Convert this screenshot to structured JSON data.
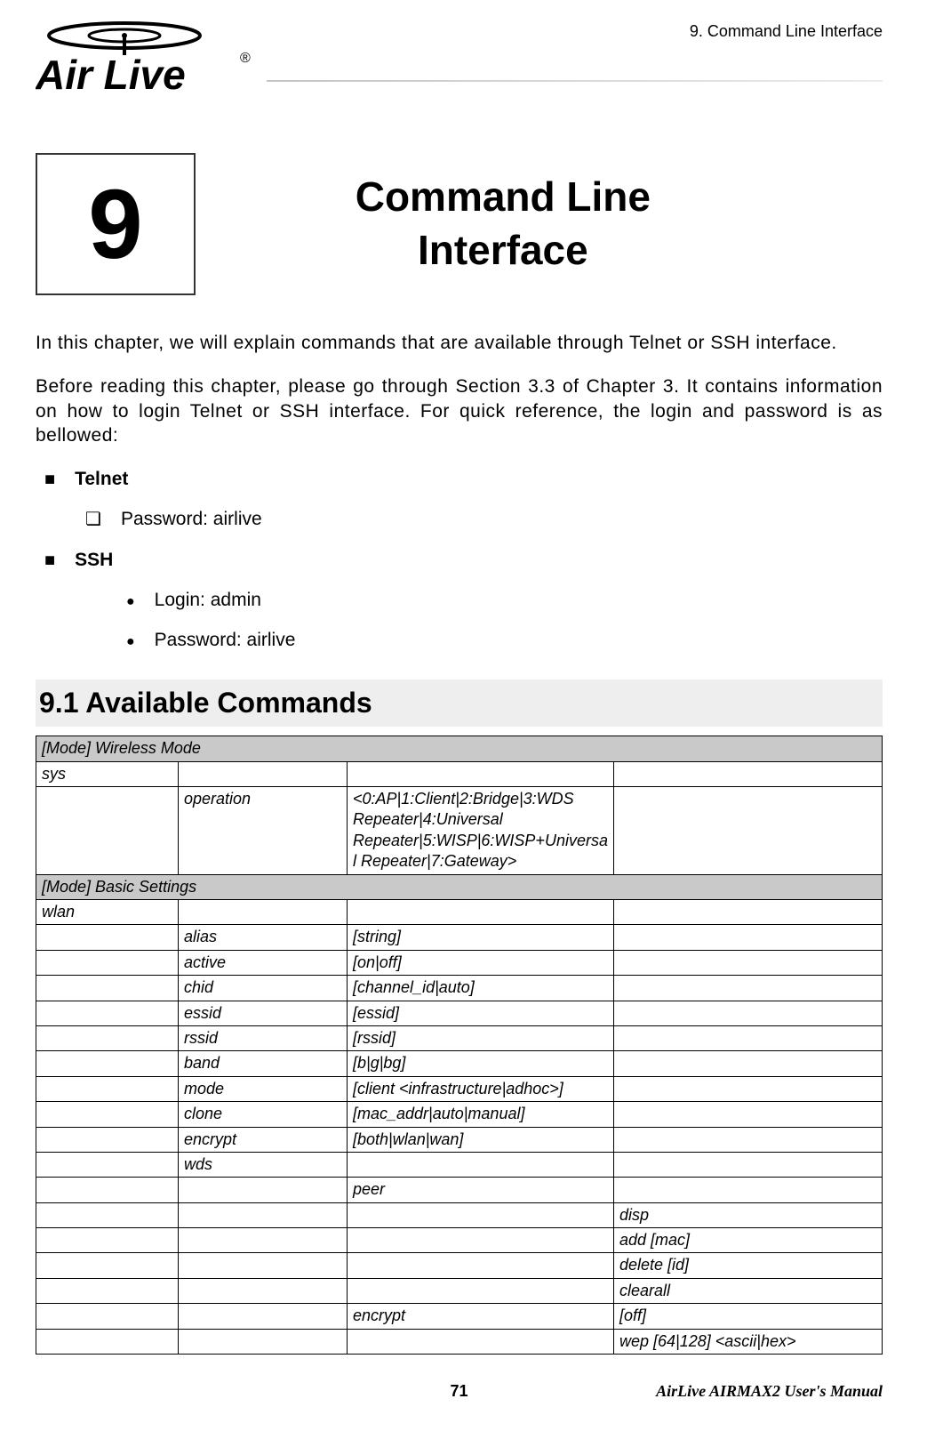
{
  "header": {
    "breadcrumb": "9. Command Line Interface",
    "logo_text": "Air Live",
    "logo_r": "®"
  },
  "chapter": {
    "number": "9",
    "title_line1": "Command Line",
    "title_line2": "Interface"
  },
  "intro": {
    "p1": "In this chapter, we will explain commands that are available through Telnet or SSH interface.",
    "p2": "Before reading this chapter, please go through Section 3.3 of Chapter 3.   It contains information on how to login Telnet or SSH interface.   For quick reference, the login and password is as bellowed:"
  },
  "credentials": {
    "telnet_label": "Telnet",
    "telnet_password": "Password: airlive",
    "ssh_label": "SSH",
    "ssh_login": "Login: admin",
    "ssh_password": "Password: airlive"
  },
  "section_title": "9.1 Available  Commands",
  "commands": {
    "mode1_header": "[Mode] Wireless Mode",
    "sys": "sys",
    "operation": "operation",
    "operation_args": "<0:AP|1:Client|2:Bridge|3:WDS Repeater|4:Universal Repeater|5:WISP|6:WISP+Universal Repeater|7:Gateway>",
    "mode2_header": "[Mode]   Basic Settings",
    "wlan": "wlan",
    "rows": [
      {
        "c2": "alias",
        "c3": "[string]"
      },
      {
        "c2": "active",
        "c3": "[on|off]"
      },
      {
        "c2": "chid",
        "c3": "[channel_id|auto]"
      },
      {
        "c2": "essid",
        "c3": "[essid]"
      },
      {
        "c2": "rssid",
        "c3": "[rssid]"
      },
      {
        "c2": "band",
        "c3": "[b|g|bg]"
      },
      {
        "c2": "mode",
        "c3": "[client <infrastructure|adhoc>]"
      },
      {
        "c2": "clone",
        "c3": "[mac_addr|auto|manual]"
      },
      {
        "c2": "encrypt",
        "c3": "[both|wlan|wan]"
      },
      {
        "c2": "wds",
        "c3": ""
      },
      {
        "c3": "peer"
      },
      {
        "c4": "disp"
      },
      {
        "c4": "add [mac]"
      },
      {
        "c4": "delete [id]"
      },
      {
        "c4": "clearall"
      },
      {
        "c3": "encrypt",
        "c4": "[off]"
      },
      {
        "c4": "wep [64|128] <ascii|hex>"
      }
    ]
  },
  "footer": {
    "page": "71",
    "right": "AirLive AIRMAX2 User's Manual"
  }
}
